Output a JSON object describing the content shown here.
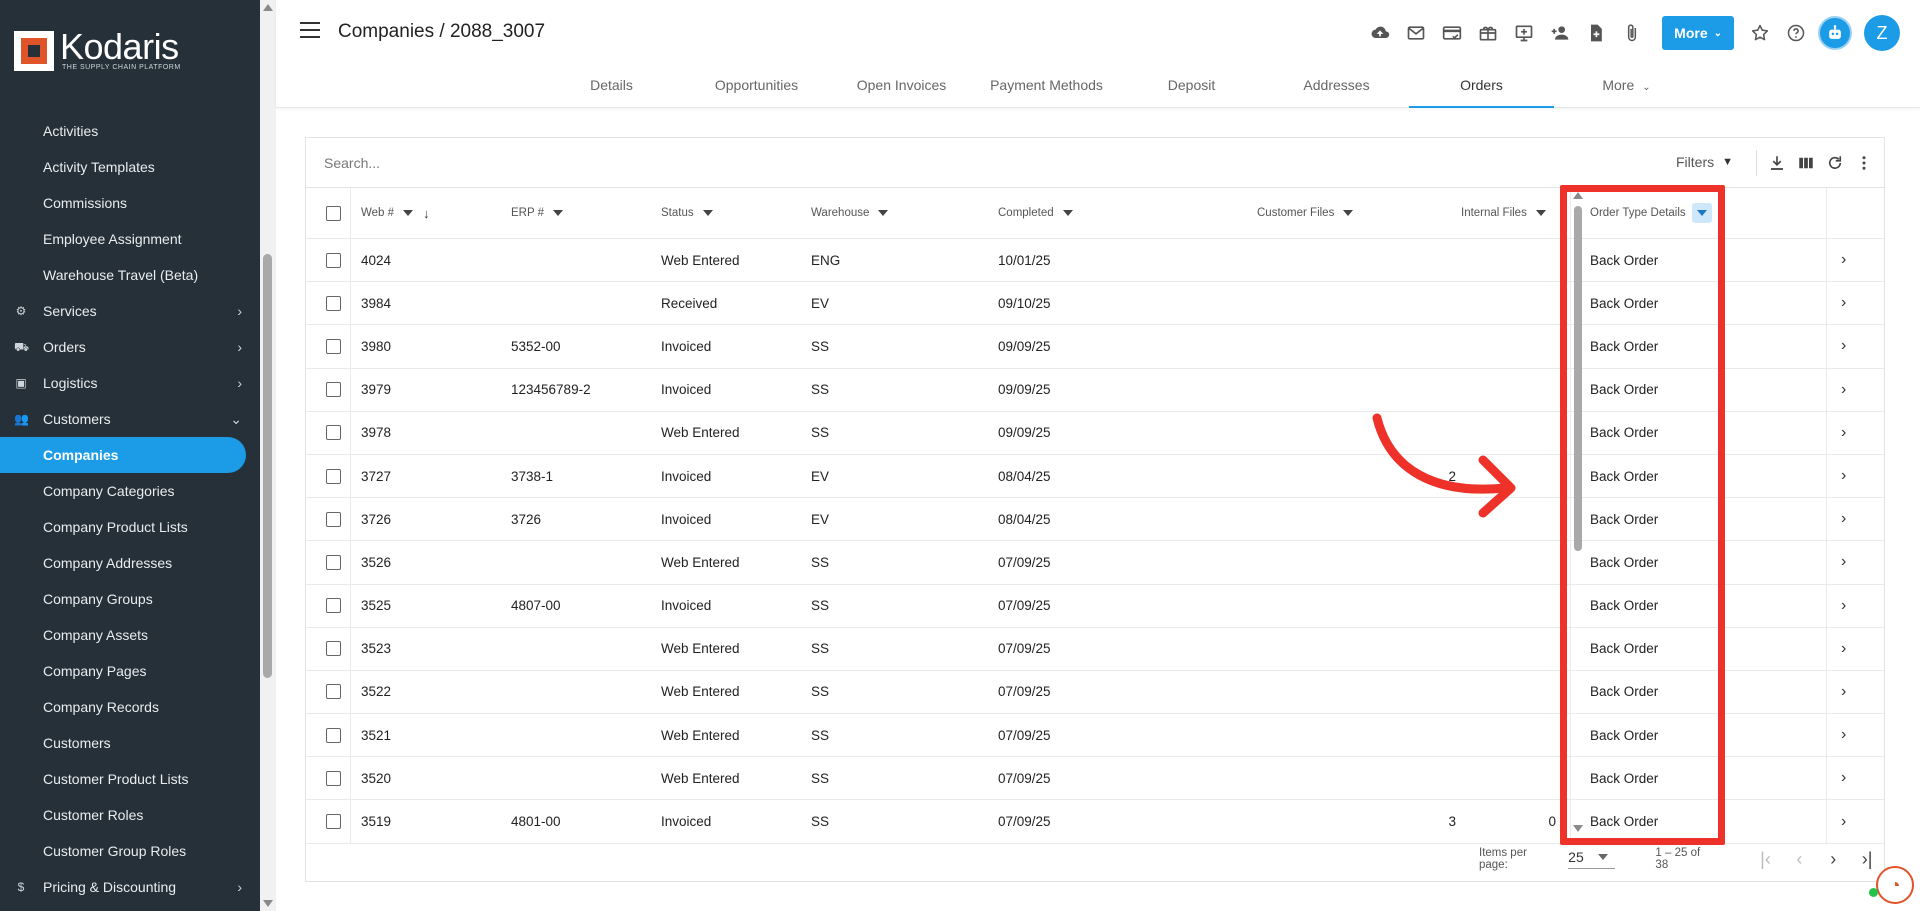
{
  "app": {
    "brand": "Kodaris",
    "tagline": "THE SUPPLY CHAIN PLATFORM"
  },
  "sidebar": {
    "items": [
      {
        "label": "Activities",
        "type": "child"
      },
      {
        "label": "Activity Templates",
        "type": "child"
      },
      {
        "label": "Commissions",
        "type": "child"
      },
      {
        "label": "Employee Assignment",
        "type": "child"
      },
      {
        "label": "Warehouse Travel (Beta)",
        "type": "child"
      },
      {
        "label": "Services",
        "type": "group",
        "icon": "gears-icon",
        "glyph": "⚙",
        "expanded": false
      },
      {
        "label": "Orders",
        "type": "group",
        "icon": "truck-icon",
        "glyph": "⛟",
        "expanded": false
      },
      {
        "label": "Logistics",
        "type": "group",
        "icon": "delivery-icon",
        "glyph": "▣",
        "expanded": false
      },
      {
        "label": "Customers",
        "type": "group",
        "icon": "people-icon",
        "glyph": "👥",
        "expanded": true
      },
      {
        "label": "Companies",
        "type": "child",
        "active": true
      },
      {
        "label": "Company Categories",
        "type": "child"
      },
      {
        "label": "Company Product Lists",
        "type": "child"
      },
      {
        "label": "Company Addresses",
        "type": "child"
      },
      {
        "label": "Company Groups",
        "type": "child"
      },
      {
        "label": "Company Assets",
        "type": "child"
      },
      {
        "label": "Company Pages",
        "type": "child"
      },
      {
        "label": "Company Records",
        "type": "child"
      },
      {
        "label": "Customers",
        "type": "child"
      },
      {
        "label": "Customer Product Lists",
        "type": "child"
      },
      {
        "label": "Customer Roles",
        "type": "child"
      },
      {
        "label": "Customer Group Roles",
        "type": "child"
      },
      {
        "label": "Pricing & Discounting",
        "type": "group",
        "icon": "dollar-icon",
        "glyph": "$",
        "expanded": false
      }
    ]
  },
  "header": {
    "title": "Companies / 2088_3007",
    "more_label": "More",
    "avatar_initial": "Z",
    "toolbar_icons": [
      "cloud-upload-icon",
      "mail-icon",
      "payment-card-icon",
      "gift-card-icon",
      "add-screen-icon",
      "add-person-icon",
      "add-document-icon",
      "attachment-icon"
    ],
    "right_icons": [
      "star-icon",
      "help-icon",
      "robot-icon"
    ]
  },
  "tabs": [
    {
      "label": "Details",
      "active": false
    },
    {
      "label": "Opportunities",
      "active": false
    },
    {
      "label": "Open Invoices",
      "active": false
    },
    {
      "label": "Payment Methods",
      "active": false
    },
    {
      "label": "Deposit",
      "active": false
    },
    {
      "label": "Addresses",
      "active": false
    },
    {
      "label": "Orders",
      "active": true
    },
    {
      "label": "More",
      "active": false,
      "dropdown": true
    }
  ],
  "search": {
    "placeholder": "Search...",
    "value": ""
  },
  "filters_label": "Filters",
  "table": {
    "columns": [
      {
        "key": "web",
        "label": "Web #"
      },
      {
        "key": "erp",
        "label": "ERP #"
      },
      {
        "key": "status",
        "label": "Status"
      },
      {
        "key": "warehouse",
        "label": "Warehouse"
      },
      {
        "key": "completed",
        "label": "Completed"
      },
      {
        "key": "customer_files",
        "label": "Customer Files"
      },
      {
        "key": "internal_files",
        "label": "Internal Files"
      },
      {
        "key": "order_type",
        "label": "Order Type Details"
      }
    ],
    "rows": [
      {
        "web": "4024",
        "erp": "",
        "status": "Web Entered",
        "warehouse": "ENG",
        "completed": "10/01/25",
        "customer_files": "",
        "internal_files": "",
        "order_type": "Back Order"
      },
      {
        "web": "3984",
        "erp": "",
        "status": "Received",
        "warehouse": "EV",
        "completed": "09/10/25",
        "customer_files": "",
        "internal_files": "",
        "order_type": "Back Order"
      },
      {
        "web": "3980",
        "erp": "5352-00",
        "status": "Invoiced",
        "warehouse": "SS",
        "completed": "09/09/25",
        "customer_files": "",
        "internal_files": "",
        "order_type": "Back Order"
      },
      {
        "web": "3979",
        "erp": "123456789-2",
        "status": "Invoiced",
        "warehouse": "SS",
        "completed": "09/09/25",
        "customer_files": "",
        "internal_files": "",
        "order_type": "Back Order"
      },
      {
        "web": "3978",
        "erp": "",
        "status": "Web Entered",
        "warehouse": "SS",
        "completed": "09/09/25",
        "customer_files": "",
        "internal_files": "",
        "order_type": "Back Order"
      },
      {
        "web": "3727",
        "erp": "3738-1",
        "status": "Invoiced",
        "warehouse": "EV",
        "completed": "08/04/25",
        "customer_files": "2",
        "internal_files": "",
        "order_type": "Back Order"
      },
      {
        "web": "3726",
        "erp": "3726",
        "status": "Invoiced",
        "warehouse": "EV",
        "completed": "08/04/25",
        "customer_files": "",
        "internal_files": "",
        "order_type": "Back Order"
      },
      {
        "web": "3526",
        "erp": "",
        "status": "Web Entered",
        "warehouse": "SS",
        "completed": "07/09/25",
        "customer_files": "",
        "internal_files": "",
        "order_type": "Back Order"
      },
      {
        "web": "3525",
        "erp": "4807-00",
        "status": "Invoiced",
        "warehouse": "SS",
        "completed": "07/09/25",
        "customer_files": "",
        "internal_files": "",
        "order_type": "Back Order"
      },
      {
        "web": "3523",
        "erp": "",
        "status": "Web Entered",
        "warehouse": "SS",
        "completed": "07/09/25",
        "customer_files": "",
        "internal_files": "",
        "order_type": "Back Order"
      },
      {
        "web": "3522",
        "erp": "",
        "status": "Web Entered",
        "warehouse": "SS",
        "completed": "07/09/25",
        "customer_files": "",
        "internal_files": "",
        "order_type": "Back Order"
      },
      {
        "web": "3521",
        "erp": "",
        "status": "Web Entered",
        "warehouse": "SS",
        "completed": "07/09/25",
        "customer_files": "",
        "internal_files": "",
        "order_type": "Back Order"
      },
      {
        "web": "3520",
        "erp": "",
        "status": "Web Entered",
        "warehouse": "SS",
        "completed": "07/09/25",
        "customer_files": "",
        "internal_files": "",
        "order_type": "Back Order"
      },
      {
        "web": "3519",
        "erp": "4801-00",
        "status": "Invoiced",
        "warehouse": "SS",
        "completed": "07/09/25",
        "customer_files": "3",
        "internal_files": "0",
        "order_type": "Back Order"
      }
    ]
  },
  "paginator": {
    "items_per_page_label": "Items per page:",
    "items_per_page": "25",
    "range": "1 – 25 of 38"
  },
  "colors": {
    "accent": "#1c9be6",
    "sidebar_bg": "#253038",
    "annotation_red": "#ee3229",
    "brand_orange": "#e0542a"
  }
}
